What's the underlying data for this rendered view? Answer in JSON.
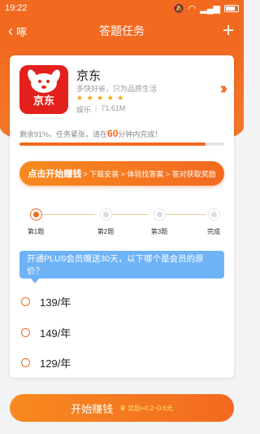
{
  "status": {
    "time": "19:22"
  },
  "header": {
    "back_label": "啄",
    "title": "答题任务",
    "add_icon": "plus-icon"
  },
  "app": {
    "name": "京东",
    "icon_text": "京东",
    "description": "多快好省，只为品质生活",
    "stars": "★ ★ ★ ★ ★",
    "rating": 5,
    "category": "娱乐",
    "size": "71.61M"
  },
  "progress": {
    "prefix": "剩余91%，任务紧张，请在",
    "minutes": "60",
    "suffix": "分钟内完成！",
    "fill_fraction": 0.91
  },
  "banner": {
    "strong": "点击开始赚钱",
    "steps": "> 下载安装 > 体验找答案 > 答对获取奖励"
  },
  "steps": [
    {
      "label": "第1题",
      "active": true
    },
    {
      "label": "第2题",
      "active": false
    },
    {
      "label": "第3题",
      "active": false
    },
    {
      "label": "完成",
      "active": false
    }
  ],
  "question": {
    "text": "开通PLUS会员赠送30天，以下哪个是会员的原价？"
  },
  "options": [
    "139/年",
    "149/年",
    "129/年"
  ],
  "start": {
    "label": "开始赚钱",
    "reward": "奖励+0.2~0.6元"
  },
  "colors": {
    "accent": "#f26a20",
    "question_bg": "#6fb3f7",
    "reward": "#ffe36b"
  }
}
